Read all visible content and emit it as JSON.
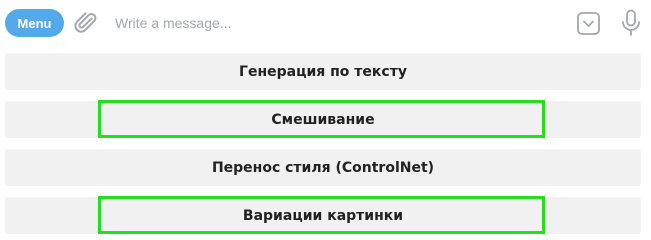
{
  "composer": {
    "menu_label": "Menu",
    "input_placeholder": "Write a message...",
    "input_value": ""
  },
  "icons": {
    "attach": "paperclip-icon",
    "keyboard_toggle": "keyboard-toggle-icon",
    "mic": "microphone-icon"
  },
  "colors": {
    "accent": "#54a9eb",
    "icon": "#a3a8ad",
    "button_bg": "#f1f1f1",
    "highlight": "#22e01e"
  },
  "keyboard": {
    "buttons": [
      {
        "label": "Генерация по тексту",
        "highlighted": false
      },
      {
        "label": "Смешивание",
        "highlighted": true
      },
      {
        "label": "Перенос стиля (ControlNet)",
        "highlighted": false
      },
      {
        "label": "Вариации картинки",
        "highlighted": true
      }
    ]
  }
}
